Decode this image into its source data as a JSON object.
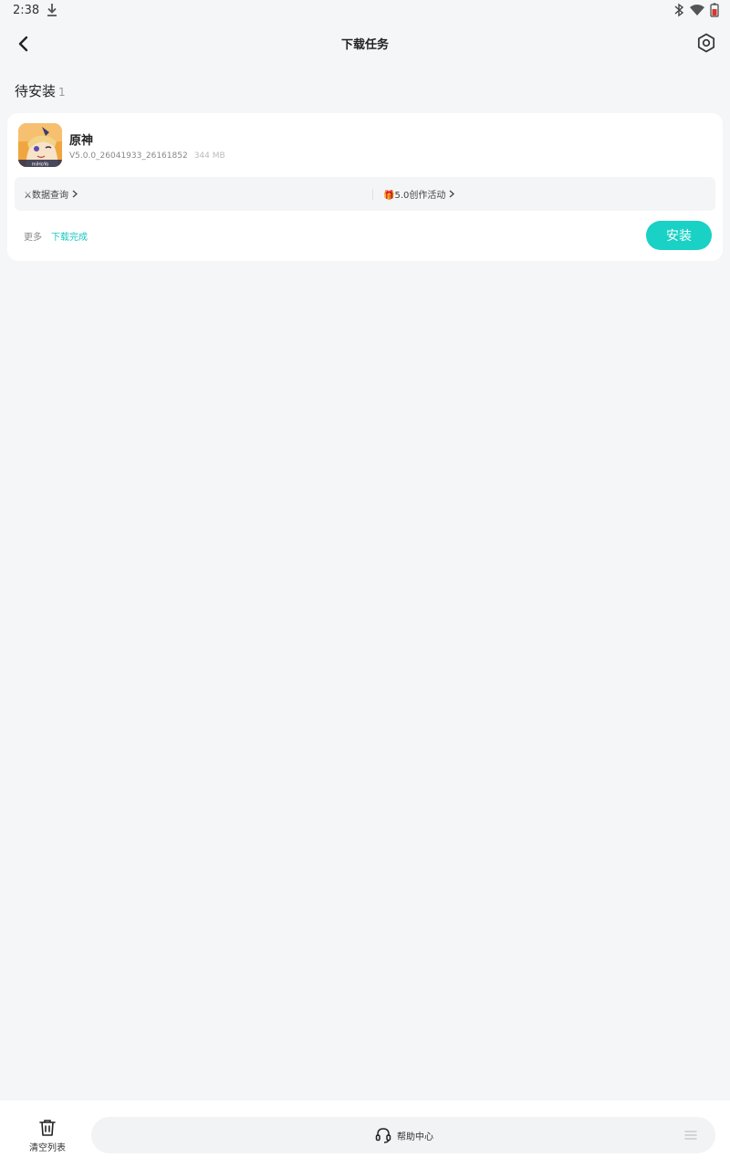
{
  "status_bar": {
    "time": "2:38"
  },
  "top_bar": {
    "title": "下载任务"
  },
  "section": {
    "title": "待安装",
    "count": "1"
  },
  "task": {
    "app_name": "原神",
    "version": "V5.0.0_26041933_26161852",
    "size": "344 MB",
    "link_left": "⚔数据查询",
    "link_right": "🎁5.0创作活动",
    "more_label": "更多",
    "status_label": "下载完成",
    "install_label": "安装"
  },
  "bottom_bar": {
    "clear_label": "清空列表",
    "help_label": "帮助中心"
  },
  "colors": {
    "accent": "#19d1c5",
    "status_text": "#1cc7c1",
    "background": "#f5f6f8"
  }
}
